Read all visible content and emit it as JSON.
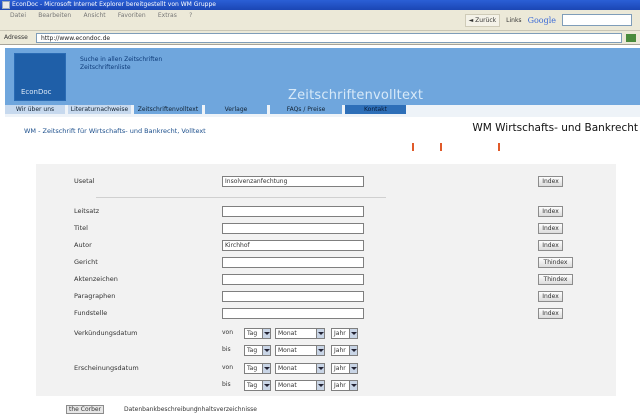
{
  "browser": {
    "window_title": "EconDoc - Microsoft Internet Explorer bereitgestellt von WM Gruppe",
    "menu": [
      "Datei",
      "Bearbeiten",
      "Ansicht",
      "Favoriten",
      "Extras",
      "?"
    ],
    "back_label": "Zurück",
    "links_label": "Links",
    "google_label": "Google",
    "address_label": "Adresse",
    "url": "http://www.econdoc.de"
  },
  "header": {
    "logo_text": "EconDoc",
    "link1": "Suche in allen Zeitschriften",
    "link2": "Zeitschriftenliste",
    "title": "Zeitschriftenvolltext"
  },
  "nav": {
    "tabs": [
      {
        "label": "Wir über uns",
        "style": "light",
        "w": 60
      },
      {
        "label": "Literaturnachweise",
        "style": "light",
        "w": 63
      },
      {
        "label": "Zeitschriftenvolltext",
        "style": "mid",
        "w": 68
      },
      {
        "label": "Verlage",
        "style": "mid",
        "w": 62
      },
      {
        "label": "FAQs / Preise",
        "style": "mid",
        "w": 72
      },
      {
        "label": "Kontakt",
        "style": "dark",
        "w": 61
      }
    ]
  },
  "breadcrumb": "WM - Zeitschrift für Wirtschafts- und Bankrecht, Volltext",
  "page_title": "WM Wirtschafts- und Bankrecht",
  "form": {
    "fields": [
      {
        "label": "Usetal",
        "value": "Insolvenzanfechtung",
        "button": "Index"
      },
      {
        "label": "Leitsatz",
        "value": "",
        "button": "Index"
      },
      {
        "label": "Titel",
        "value": "",
        "button": "Index"
      },
      {
        "label": "Autor",
        "value": "Kirchhof",
        "button": "Index"
      },
      {
        "label": "Gericht",
        "value": "",
        "button": "Thindex"
      },
      {
        "label": "Aktenzeichen",
        "value": "",
        "button": "Thindex"
      },
      {
        "label": "Paragraphen",
        "value": "",
        "button": "Index"
      },
      {
        "label": "Fundstelle",
        "value": "",
        "button": "Index"
      }
    ],
    "date_groups": [
      {
        "label": "Verkündungsdatum",
        "from": "von",
        "to": "bis",
        "day": "Tag",
        "month": "Monat",
        "year": "Jahr"
      },
      {
        "label": "Erscheinungsdatum",
        "from": "von",
        "to": "bis",
        "day": "Tag",
        "month": "Monat",
        "year": "Jahr"
      }
    ]
  },
  "bottom": {
    "button_fragment": "the Corber",
    "text1": "Datenbankbeschreibung",
    "text2": "Inhaltsverzeichnisse"
  }
}
